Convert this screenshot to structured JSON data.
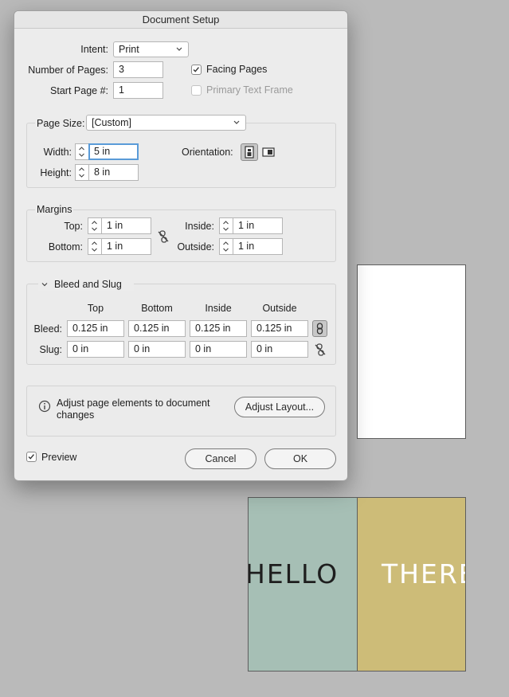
{
  "window": {
    "title": "Document Setup"
  },
  "intent": {
    "label": "Intent:",
    "value": "Print"
  },
  "pages": {
    "label": "Number of Pages:",
    "value": "3"
  },
  "start_page": {
    "label": "Start Page #:",
    "value": "1"
  },
  "facing_pages": {
    "label": "Facing Pages",
    "checked": true
  },
  "primary_text_frame": {
    "label": "Primary Text Frame",
    "checked": false
  },
  "page_size": {
    "label": "Page Size:",
    "value": "[Custom]",
    "width_label": "Width:",
    "width": "5 in",
    "height_label": "Height:",
    "height": "8 in",
    "orientation_label": "Orientation:"
  },
  "margins": {
    "title": "Margins",
    "top_label": "Top:",
    "top": "1 in",
    "bottom_label": "Bottom:",
    "bottom": "1 in",
    "inside_label": "Inside:",
    "inside": "1 in",
    "outside_label": "Outside:",
    "outside": "1 in"
  },
  "bleed_slug": {
    "title": "Bleed and Slug",
    "headers": [
      "Top",
      "Bottom",
      "Inside",
      "Outside"
    ],
    "bleed_label": "Bleed:",
    "bleed": [
      "0.125 in",
      "0.125 in",
      "0.125 in",
      "0.125 in"
    ],
    "slug_label": "Slug:",
    "slug": [
      "0 in",
      "0 in",
      "0 in",
      "0 in"
    ]
  },
  "adjust": {
    "text_line1": "Adjust page elements to document",
    "text_line2": "changes",
    "button": "Adjust Layout..."
  },
  "preview": {
    "label": "Preview",
    "checked": true
  },
  "buttons": {
    "cancel": "Cancel",
    "ok": "OK"
  },
  "canvas": {
    "left_text": "HELLO",
    "right_text": "THERE"
  },
  "colors": {
    "accent": "#5a9bd8",
    "page_left": "#a6bfb5",
    "page_right": "#cdbc78"
  }
}
